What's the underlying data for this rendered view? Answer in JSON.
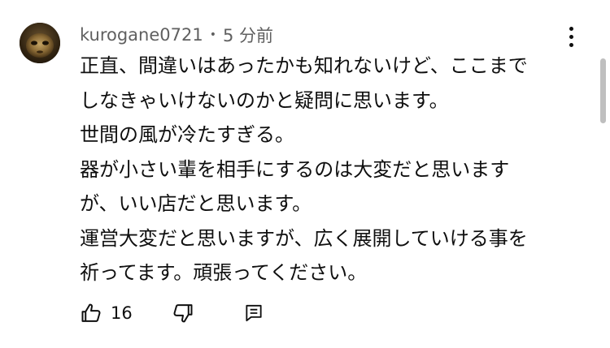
{
  "comment": {
    "author": "kurogane0721",
    "separator": "•",
    "timestamp": "5 分前",
    "lines": [
      "正直、間違いはあったかも知れないけど、ここまで",
      "しなきゃいけないのかと疑問に思います。",
      "世間の風が冷たすぎる。",
      "器が小さい輩を相手にするのは大変だと思います",
      "が、いい店だと思います。",
      "運営大変だと思いますが、広く展開していける事を",
      "祈ってます。頑張ってください。"
    ],
    "like_count": "16"
  },
  "icons": {
    "avatar": "avatar-image",
    "menu": "more-vertical-icon",
    "like": "thumb-up-icon",
    "dislike": "thumb-down-icon",
    "reply": "reply-comment-icon"
  },
  "colors": {
    "text": "#0f0f0f",
    "meta": "#606060",
    "background": "#ffffff"
  }
}
